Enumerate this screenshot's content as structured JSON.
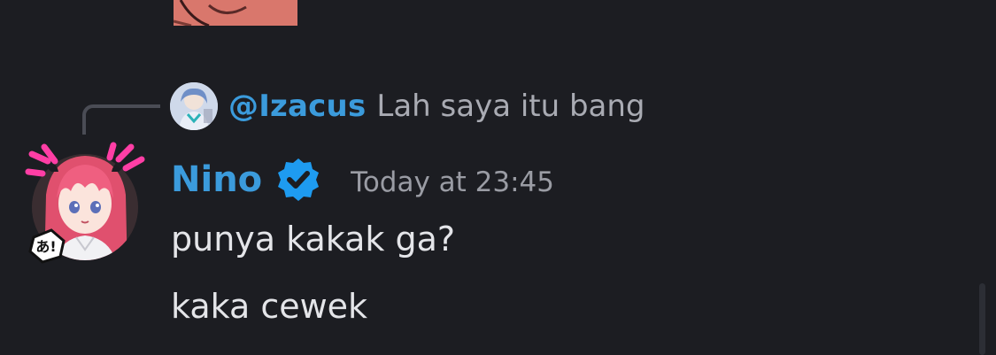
{
  "reply": {
    "username": "@Izacus",
    "text": "Lah saya itu bang"
  },
  "message": {
    "author": "Nino",
    "timestamp": "Today at 23:45",
    "lines": [
      "punya kakak ga?",
      "kaka cewek"
    ]
  },
  "avatar_decoration": {
    "badge_text": "あ!"
  },
  "colors": {
    "background": "#1c1d22",
    "username": "#3b9bdc",
    "message_text": "#e4e5e9",
    "muted_text": "#9a9ca4",
    "verified_badge": "#1e9bf0",
    "decoration_pink": "#ff3ea5"
  },
  "icons": {
    "verified": "verified-check-badge",
    "reply_avatar": "user-avatar",
    "author_avatar": "anime-avatar-with-decoration"
  }
}
